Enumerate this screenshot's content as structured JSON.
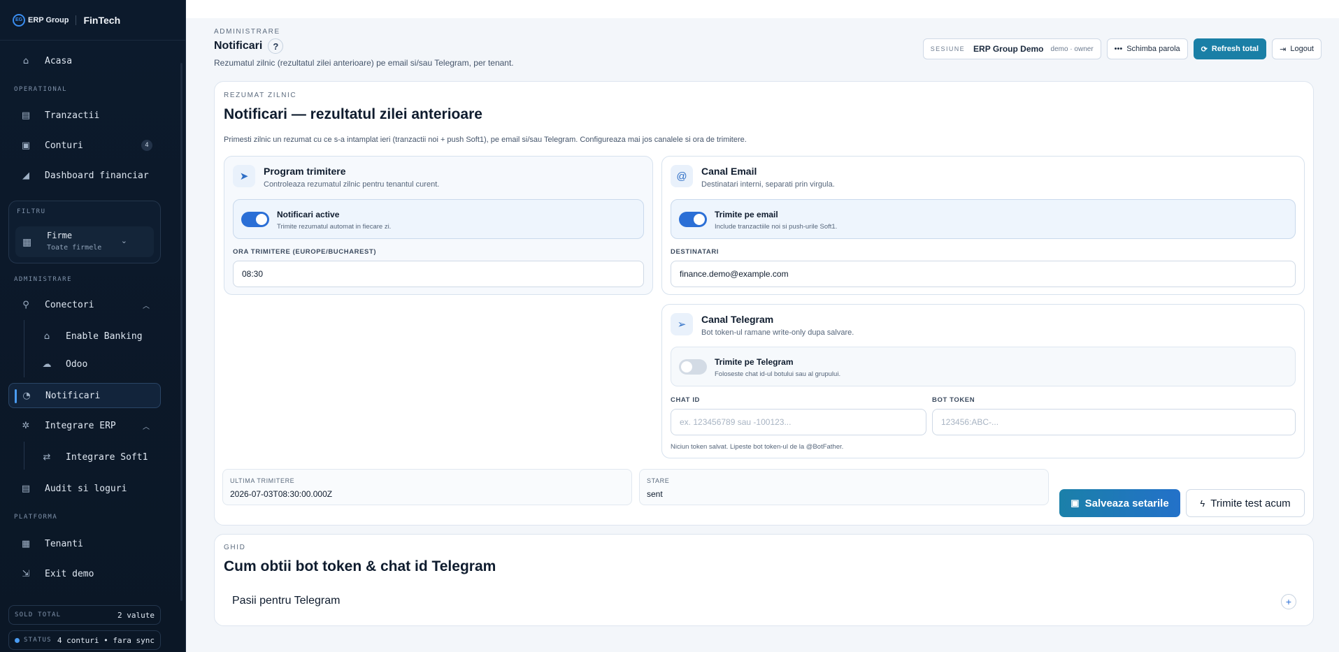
{
  "brand": {
    "logo_text": "EG",
    "name": "ERP Group",
    "product": "FinTech"
  },
  "sidebar": {
    "home": "Acasa",
    "sections": {
      "operational": "OPERATIONAL",
      "administrare": "ADMINISTRARE",
      "platforma": "PLATFORMA"
    },
    "operational_items": [
      {
        "label": "Tranzactii",
        "icon": "receipt-icon"
      },
      {
        "label": "Conturi",
        "icon": "ledger-icon",
        "badge": "4"
      },
      {
        "label": "Dashboard financiar",
        "icon": "chart-icon"
      }
    ],
    "filter": {
      "label": "FILTRU",
      "title": "Firme",
      "value": "Toate firmele"
    },
    "admin_items": {
      "conectori": "Conectori",
      "enable_banking": "Enable Banking",
      "odoo": "Odoo",
      "notificari": "Notificari",
      "integrare_erp": "Integrare ERP",
      "integrare_soft1": "Integrare Soft1",
      "audit": "Audit si loguri"
    },
    "platform_items": {
      "tenanti": "Tenanti",
      "exit": "Exit demo"
    },
    "footer": {
      "sold_label": "SOLD TOTAL",
      "sold_value": "2 valute",
      "status_label": "STATUS",
      "status_value": "4 conturi • fara sync"
    }
  },
  "header": {
    "eyebrow": "ADMINISTRARE",
    "title": "Notificari",
    "help": "?",
    "subtitle": "Rezumatul zilnic (rezultatul zilei anterioare) pe email si/sau Telegram, per tenant.",
    "session_label": "SESIUNE",
    "session_name": "ERP Group Demo",
    "session_meta": "demo · owner",
    "change_password": "Schimba parola",
    "refresh": "Refresh total",
    "logout": "Logout"
  },
  "summary_card": {
    "eyebrow": "REZUMAT ZILNIC",
    "title": "Notificari — rezultatul zilei anterioare",
    "intro": "Primesti zilnic un rezumat cu ce s-a intamplat ieri (tranzactii noi + push Soft1), pe email si/sau Telegram. Configureaza mai jos canalele si ora de trimitere.",
    "schedule": {
      "title": "Program trimitere",
      "subtitle": "Controleaza rezumatul zilnic pentru tenantul curent.",
      "toggle_title": "Notificari active",
      "toggle_sub": "Trimite rezumatul automat in fiecare zi.",
      "toggle_on": true,
      "time_label": "ORA TRIMITERE (EUROPE/BUCHAREST)",
      "time_value": "08:30"
    },
    "email": {
      "title": "Canal Email",
      "subtitle": "Destinatari interni, separati prin virgula.",
      "toggle_title": "Trimite pe email",
      "toggle_sub": "Include tranzactiile noi si push-urile Soft1.",
      "toggle_on": true,
      "recipients_label": "DESTINATARI",
      "recipients_value": "finance.demo@example.com"
    },
    "telegram": {
      "title": "Canal Telegram",
      "subtitle": "Bot token-ul ramane write-only dupa salvare.",
      "toggle_title": "Trimite pe Telegram",
      "toggle_sub": "Foloseste chat id-ul botului sau al grupului.",
      "toggle_on": false,
      "chat_label": "CHAT ID",
      "chat_placeholder": "ex. 123456789 sau -100123...",
      "token_label": "BOT TOKEN",
      "token_placeholder": "123456:ABC-...",
      "hint": "Niciun token salvat. Lipeste bot token-ul de la @BotFather."
    },
    "last_sent_label": "ULTIMA TRIMITERE",
    "last_sent_value": "2026-07-03T08:30:00.000Z",
    "state_label": "STARE",
    "state_value": "sent",
    "save_button": "Salveaza setarile",
    "test_button": "Trimite test acum"
  },
  "guide_card": {
    "eyebrow": "GHID",
    "title": "Cum obtii bot token & chat id Telegram",
    "accordion_label": "Pasii pentru Telegram",
    "accordion_icon": "+"
  },
  "colors": {
    "sidebar_bg": "#0c1a2c",
    "accent": "#2b6fd6",
    "primary_button": "#1a7fa6"
  }
}
